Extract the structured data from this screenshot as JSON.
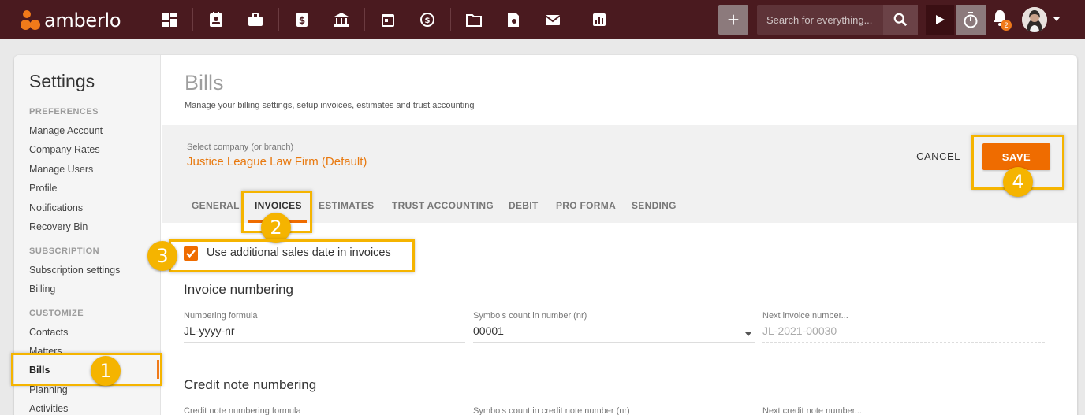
{
  "app": {
    "name": "amberlo"
  },
  "colors": {
    "accent": "#ef6c00",
    "topbar": "#4a1a1f",
    "highlight": "#f5b400"
  },
  "topbar": {
    "nav_icons": [
      "dashboard-icon",
      "contacts-icon",
      "matters-icon",
      "bills-icon",
      "trust-icon",
      "calendar-icon",
      "time-icon",
      "folder-icon",
      "documents-icon",
      "mail-icon",
      "reports-icon"
    ],
    "search_placeholder": "Search for everything...",
    "notifications_count": "2"
  },
  "sidebar": {
    "title": "Settings",
    "groups": [
      {
        "label": "PREFERENCES",
        "items": [
          "Manage Account",
          "Company Rates",
          "Manage Users",
          "Profile",
          "Notifications",
          "Recovery Bin"
        ]
      },
      {
        "label": "SUBSCRIPTION",
        "items": [
          "Subscription settings",
          "Billing"
        ]
      },
      {
        "label": "CUSTOMIZE",
        "items": [
          "Contacts",
          "Matters",
          "Bills",
          "Planning",
          "Activities"
        ]
      }
    ],
    "active_item": "Bills"
  },
  "page": {
    "title": "Bills",
    "subtitle": "Manage your billing settings, setup invoices, estimates and trust accounting"
  },
  "company": {
    "label": "Select company (or branch)",
    "value": "Justice League Law Firm (Default)"
  },
  "actions": {
    "cancel": "CANCEL",
    "save": "SAVE"
  },
  "tabs": [
    "GENERAL",
    "INVOICES",
    "ESTIMATES",
    "TRUST ACCOUNTING",
    "DEBIT",
    "PRO FORMA",
    "SENDING"
  ],
  "active_tab": "INVOICES",
  "invoice_settings": {
    "additional_sales_date_label": "Use additional sales date in invoices",
    "additional_sales_date_checked": true
  },
  "invoice_numbering": {
    "title": "Invoice numbering",
    "formula_label": "Numbering formula",
    "formula_value": "JL-yyyy-nr",
    "symbols_label": "Symbols count in number (nr)",
    "symbols_value": "00001",
    "next_label": "Next invoice number...",
    "next_value": "JL-2021-00030"
  },
  "credit_note_numbering": {
    "title": "Credit note numbering",
    "formula_label": "Credit note numbering formula",
    "symbols_label": "Symbols count in credit note number (nr)",
    "next_label": "Next credit note number..."
  },
  "annotations": [
    "1",
    "2",
    "3",
    "4"
  ]
}
